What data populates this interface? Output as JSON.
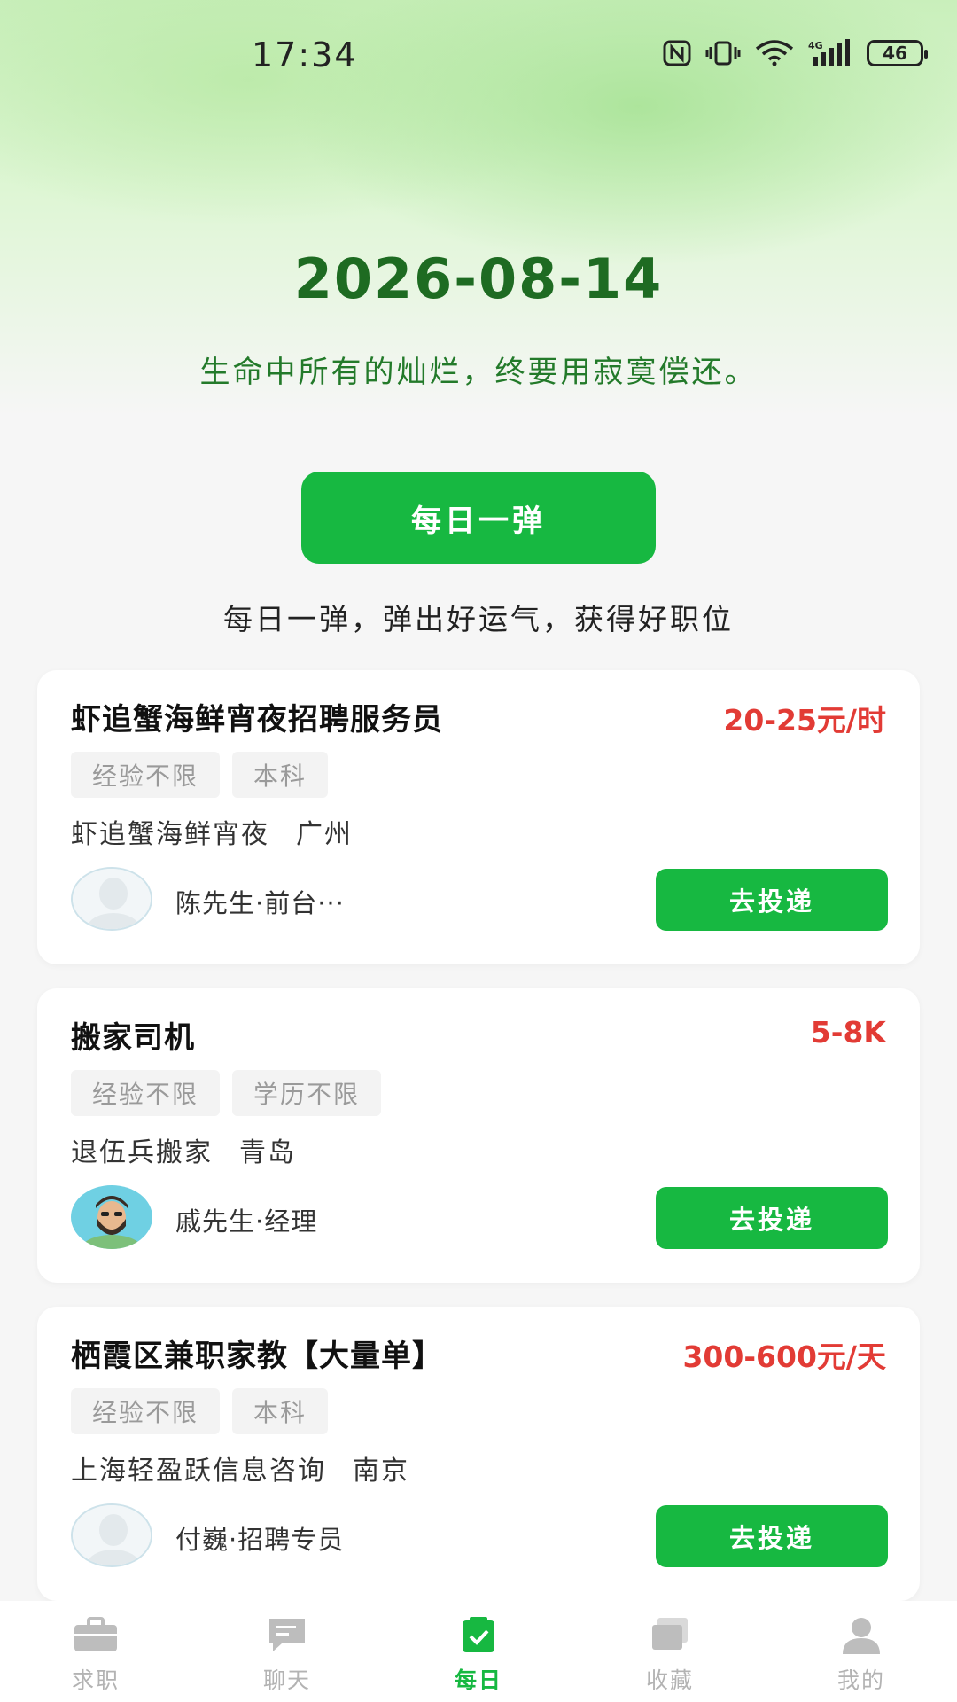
{
  "status_bar": {
    "time": "17:34",
    "battery": "46",
    "network": "4G"
  },
  "header": {
    "date": "2026-08-14",
    "motto": "生命中所有的灿烂，终要用寂寞偿还。"
  },
  "daily": {
    "button_label": "每日一弹",
    "tagline": "每日一弹，弹出好运气，获得好职位"
  },
  "jobs": [
    {
      "title": "虾追蟹海鲜宵夜招聘服务员",
      "salary": "20-25元/时",
      "tags": [
        "经验不限",
        "本科"
      ],
      "company": "虾追蟹海鲜宵夜",
      "city": "广州",
      "recruiter": "陈先生·前台···",
      "apply_label": "去投递",
      "avatar": "default-avatar-icon"
    },
    {
      "title": "搬家司机",
      "salary": "5-8K",
      "tags": [
        "经验不限",
        "学历不限"
      ],
      "company": "退伍兵搬家",
      "city": "青岛",
      "recruiter": "戚先生·经理",
      "apply_label": "去投递",
      "avatar": "bearded-man-avatar-icon"
    },
    {
      "title": "栖霞区兼职家教【大量单】",
      "salary": "300-600元/天",
      "tags": [
        "经验不限",
        "本科"
      ],
      "company": "上海轻盈跃信息咨询",
      "city": "南京",
      "recruiter": "付巍·招聘专员",
      "apply_label": "去投递",
      "avatar": "default-avatar-icon"
    }
  ],
  "tabbar": {
    "items": [
      {
        "label": "求职",
        "icon": "briefcase-icon"
      },
      {
        "label": "聊天",
        "icon": "chat-icon"
      },
      {
        "label": "每日",
        "icon": "daily-check-icon",
        "active": true
      },
      {
        "label": "收藏",
        "icon": "collection-icon"
      },
      {
        "label": "我的",
        "icon": "profile-icon"
      }
    ]
  },
  "colors": {
    "accent": "#17b841",
    "salary": "#e23b35",
    "date": "#1e6b22"
  }
}
